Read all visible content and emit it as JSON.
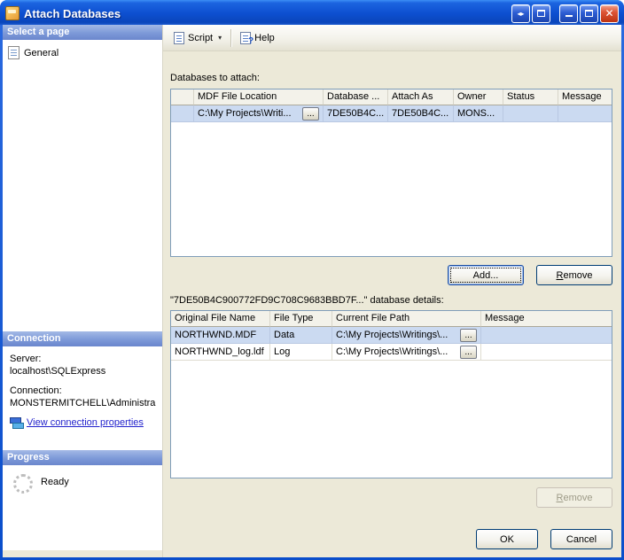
{
  "window": {
    "title": "Attach Databases",
    "controls": {
      "float_glyph": "◂▸",
      "close_glyph": "✕"
    }
  },
  "sidebar": {
    "select_page": {
      "header": "Select a page",
      "items": [
        {
          "label": "General"
        }
      ]
    },
    "connection": {
      "header": "Connection",
      "server_label": "Server:",
      "server_value": "localhost\\SQLExpress",
      "connection_label": "Connection:",
      "connection_value": "MONSTERMITCHELL\\Administra",
      "link": "View connection properties"
    },
    "progress": {
      "header": "Progress",
      "status": "Ready"
    }
  },
  "toolbar": {
    "script_label": "Script",
    "dropdown_glyph": "▾",
    "help_label": "Help"
  },
  "main": {
    "attach_label": "Databases to attach:",
    "grid1": {
      "columns": [
        "",
        "MDF File Location",
        "Database ...",
        "Attach As",
        "Owner",
        "Status",
        "Message"
      ],
      "rows": [
        {
          "mdf": "C:\\My Projects\\Writi...",
          "browse": "...",
          "database": "7DE50B4C...",
          "attach_as": "7DE50B4C...",
          "owner": "MONS...",
          "status": "",
          "message": ""
        }
      ]
    },
    "add_label": "Add...",
    "remove_label": "Remove",
    "details_label": "\"7DE50B4C900772FD9C708C9683BBD7F...\" database details:",
    "grid2": {
      "columns": [
        "Original File Name",
        "File Type",
        "Current File Path",
        "Message"
      ],
      "rows": [
        {
          "name": "NORTHWND.MDF",
          "type": "Data",
          "path": "C:\\My Projects\\Writings\\...",
          "browse": "...",
          "message": ""
        },
        {
          "name": "NORTHWND_log.ldf",
          "type": "Log",
          "path": "C:\\My Projects\\Writings\\...",
          "browse": "...",
          "message": ""
        }
      ]
    },
    "remove2_label": "Remove",
    "ok_label": "OK",
    "cancel_label": "Cancel"
  }
}
